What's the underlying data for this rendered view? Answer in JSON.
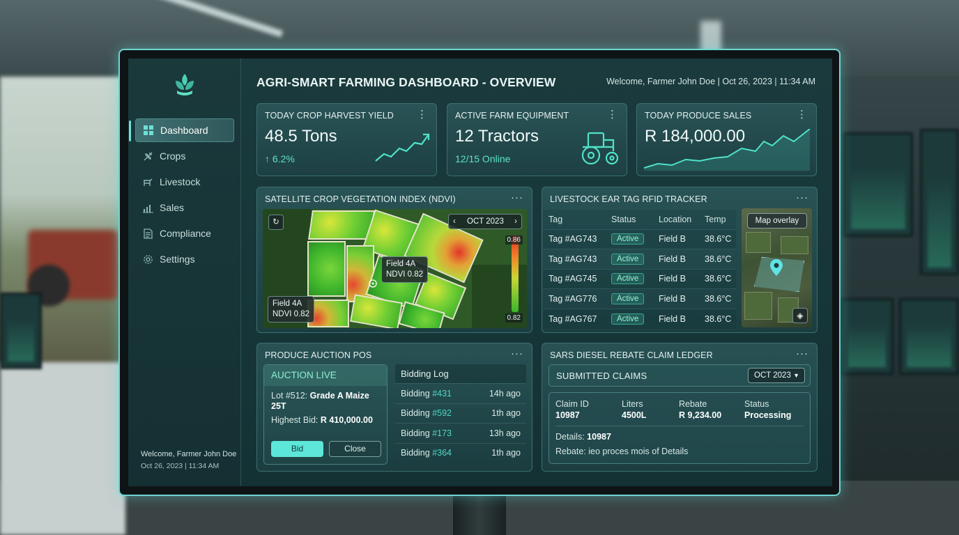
{
  "app": {
    "title": "AGRI-SMART FARMING DASHBOARD - OVERVIEW",
    "welcome": "Welcome, Farmer John Doe | Oct 26, 2023 | 11:34 AM",
    "accent_color": "#5de6da"
  },
  "sidebar": {
    "items": [
      {
        "label": "Dashboard",
        "icon": "grid-icon",
        "active": true
      },
      {
        "label": "Crops",
        "icon": "crop-icon"
      },
      {
        "label": "Livestock",
        "icon": "livestock-icon"
      },
      {
        "label": "Sales",
        "icon": "bar-chart-icon"
      },
      {
        "label": "Compliance",
        "icon": "document-icon"
      },
      {
        "label": "Settings",
        "icon": "gear-icon"
      }
    ],
    "footer_name": "Welcome, Farmer John Doe",
    "footer_date": "Oct 26, 2023 | 11:34 AM"
  },
  "kpis": [
    {
      "title": "TODAY CROP HARVEST YIELD",
      "value": "48.5 Tons",
      "sub": "6.2%",
      "trend": "up"
    },
    {
      "title": "ACTIVE FARM EQUIPMENT",
      "value": "12 Tractors",
      "sub": "12/15 Online",
      "icon": "tractor-icon"
    },
    {
      "title": "TODAY PRODUCE SALES",
      "value": "R 184,000.00",
      "trend_icon": "area-chart"
    }
  ],
  "ndvi": {
    "title": "SATELLITE CROP VEGETATION INDEX (NDVI)",
    "period": "OCT 2023",
    "tooltip_main": {
      "field": "Field 4A",
      "value": "NDVI 0.82"
    },
    "tooltip_corner": {
      "field": "Field 4A",
      "value": "NDVI 0.82"
    },
    "scale_max": "0.86",
    "scale_min": "0.82"
  },
  "rfid": {
    "title": "LIVESTOCK EAR TAG RFID TRACKER",
    "columns": [
      "Tag",
      "Status",
      "Location",
      "Temp"
    ],
    "rows": [
      [
        "Tag #AG743",
        "Active",
        "Field B",
        "38.6°C"
      ],
      [
        "Tag #AG743",
        "Active",
        "Field B",
        "38.6°C"
      ],
      [
        "Tag #AG745",
        "Active",
        "Field B",
        "38.6°C"
      ],
      [
        "Tag #AG776",
        "Active",
        "Field B",
        "38.6°C"
      ],
      [
        "Tag #AG767",
        "Active",
        "Field B",
        "38.6°C"
      ]
    ],
    "map_button": "Map overlay"
  },
  "auction": {
    "title": "PRODUCE AUCTION POS",
    "live_label": "AUCTION LIVE",
    "lot_prefix": "Lot #512:",
    "lot_name": "Grade A Maize 25T",
    "highest_prefix": "Highest Bid:",
    "highest_value": "R 410,000.00",
    "bid_label": "Bid",
    "close_label": "Close",
    "log_title": "Bidding Log",
    "log": [
      {
        "label": "Bidding",
        "id": "#431",
        "time": "14h ago"
      },
      {
        "label": "Bidding",
        "id": "#592",
        "time": "1th ago"
      },
      {
        "label": "Bidding",
        "id": "#173",
        "time": "13h ago"
      },
      {
        "label": "Bidding",
        "id": "#364",
        "time": "1th ago"
      }
    ]
  },
  "sars": {
    "title": "SARS DIESEL REBATE CLAIM LEDGER",
    "section_label": "SUBMITTED CLAIMS",
    "period": "OCT 2023",
    "claim": {
      "id_label": "Claim ID",
      "id": "10987",
      "liters_label": "Liters",
      "liters": "4500L",
      "rebate_label": "Rebate",
      "rebate": "R 9,234.00",
      "status_label": "Status",
      "status": "Processing"
    },
    "details_label": "Details:",
    "details_value": "10987",
    "rebate_note": "Rebate: ieo proces mois of Details"
  }
}
